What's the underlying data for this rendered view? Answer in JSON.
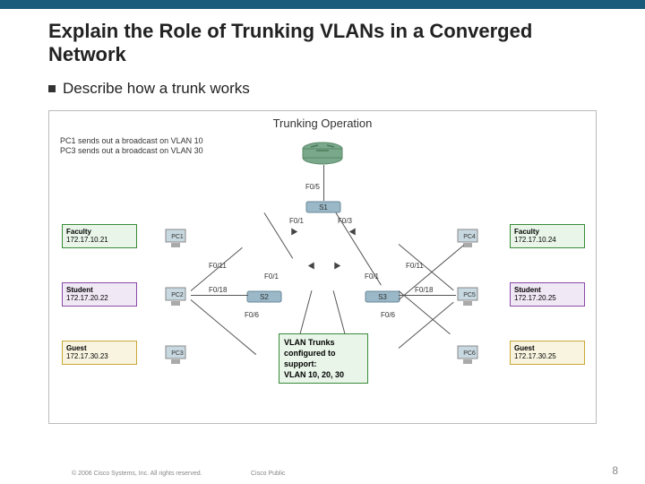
{
  "header": {
    "title": "Explain the Role of Trunking VLANs in a Converged Network"
  },
  "bullet": {
    "text": "Describe how a trunk works"
  },
  "diagram": {
    "title": "Trunking Operation",
    "broadcast_line1": "PC1 sends out a broadcast on VLAN 10",
    "broadcast_line2": "PC3 sends out a broadcast on VLAN 30",
    "ports": {
      "f05": "F0/5",
      "f01": "F0/1",
      "f03": "F0/3",
      "f011_l": "F0/11",
      "f018_l": "F0/18",
      "f06_l": "F0/6",
      "f011_r": "F0/11",
      "f018_r": "F0/18",
      "f06_r": "F0/6",
      "f01_s2": "F0/1",
      "f01_s3": "F0/1"
    },
    "switches": {
      "s1": "S1",
      "s2": "S2",
      "s3": "S3"
    },
    "pcs": {
      "pc1": "PC1",
      "pc2": "PC2",
      "pc3": "PC3",
      "pc4": "PC4",
      "pc5": "PC5",
      "pc6": "PC6"
    },
    "boxes": {
      "fac_l": {
        "title": "Faculty",
        "ip": "172.17.10.21"
      },
      "stu_l": {
        "title": "Student",
        "ip": "172.17.20.22"
      },
      "gue_l": {
        "title": "Guest",
        "ip": "172.17.30.23"
      },
      "fac_r": {
        "title": "Faculty",
        "ip": "172.17.10.24"
      },
      "stu_r": {
        "title": "Student",
        "ip": "172.17.20.25"
      },
      "gue_r": {
        "title": "Guest",
        "ip": "172.17.30.25"
      }
    },
    "trunk_box": {
      "l1": "VLAN Trunks",
      "l2": "configured to",
      "l3": "support:",
      "l4": "VLAN 10, 20, 30"
    }
  },
  "footer": {
    "copyright": "© 2006 Cisco Systems, Inc. All rights reserved.",
    "label": "Cisco Public",
    "page": "8"
  }
}
